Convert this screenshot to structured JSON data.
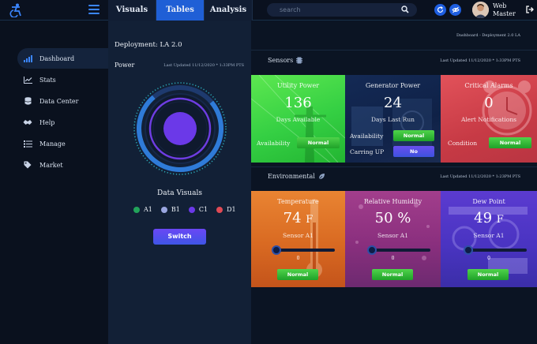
{
  "header": {
    "tabs": [
      {
        "label": "Visuals"
      },
      {
        "label": "Tables"
      },
      {
        "label": "Analysis"
      }
    ],
    "search_placeholder": "search",
    "user_name": "Web Master"
  },
  "sidebar": {
    "items": [
      {
        "label": "Dashboard",
        "icon": "bar-chart-icon"
      },
      {
        "label": "Stats",
        "icon": "line-chart-icon"
      },
      {
        "label": "Data Center",
        "icon": "database-icon"
      },
      {
        "label": "Help",
        "icon": "help-icon"
      },
      {
        "label": "Manage",
        "icon": "list-icon"
      },
      {
        "label": "Market",
        "icon": "tag-icon"
      }
    ]
  },
  "power_panel": {
    "deployment": "Deployment: LA 2.0",
    "title": "Power",
    "updated": "Last Updated 11/12/2020 * 1:33PM PTS",
    "data_visuals_title": "Data Visuals",
    "legend": [
      {
        "label": "A1",
        "color": "#22a35a"
      },
      {
        "label": "B1",
        "color": "#9aa6e0"
      },
      {
        "label": "C1",
        "color": "#6b39e8"
      },
      {
        "label": "D1",
        "color": "#e04a55"
      }
    ],
    "switch_label": "Switch"
  },
  "main": {
    "breadcrumb": "Dashboard - Deployment 2.0 LA",
    "sensors": {
      "title": "Sensors",
      "updated": "Last Updated 11/12/2020 * 1:33PM PTS",
      "utility": {
        "title": "Utility Power",
        "value": "136",
        "subtitle": "Days Available",
        "label": "Availability",
        "status": "Normal"
      },
      "generator": {
        "title": "Generator Power",
        "value": "24",
        "subtitle": "Days Last Run",
        "label1": "Availability",
        "status1": "Normal",
        "label2": "Carring UP",
        "status2": "No"
      },
      "alarms": {
        "title": "Critical Alarms",
        "value": "0",
        "subtitle": "Alert Notifications",
        "label": "Condition",
        "status": "Normal"
      }
    },
    "environmental": {
      "title": "Environmental",
      "updated": "Last Updated 11/12/2020 * 1:23PM PTS",
      "temperature": {
        "title": "Temperature",
        "value": "74",
        "unit": "F",
        "sensor": "Sensor A1",
        "slider_value": "0",
        "status": "Normal"
      },
      "humidity": {
        "title": "Relative Humidity",
        "value": "50",
        "unit": "%",
        "sensor": "Sensor A1",
        "slider_value": "0",
        "status": "Normal"
      },
      "dewpoint": {
        "title": "Dew Point",
        "value": "49",
        "unit": "F",
        "sensor": "Sensor A1",
        "slider_value": "0",
        "status": "Normal"
      }
    }
  }
}
